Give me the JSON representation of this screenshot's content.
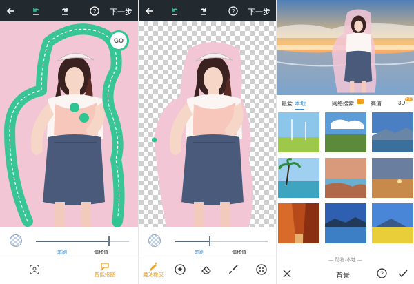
{
  "panel1": {
    "topbar": {
      "back_icon": "arrow-left-icon",
      "undo_icon": "undo-icon",
      "redo_icon": "redo-icon",
      "help_icon": "help-circle-icon",
      "next_label": "下一步"
    },
    "go_label": "GO",
    "slider": {
      "left_label": "笔刷",
      "right_label": "偏移值",
      "value": 0.8
    },
    "toolbar": {
      "left_icon": "face-scan-icon",
      "active_label": "智能抠图"
    }
  },
  "panel2": {
    "topbar": {
      "next_label": "下一步"
    },
    "slider": {
      "left_label": "笔刷",
      "right_label": "偏移值",
      "value": 0.37
    },
    "toolbar": {
      "labels": [
        "魔法橡皮"
      ],
      "icons": [
        "magic-eraser-icon",
        "star-circle-icon",
        "eraser-icon",
        "brush-icon",
        "more-grid-icon"
      ]
    }
  },
  "panel3": {
    "tabs": [
      {
        "label": "最爱"
      },
      {
        "label": "本地"
      },
      {
        "label": "网络搜索"
      },
      {
        "label": "高清"
      },
      {
        "label": "3D"
      }
    ],
    "active_tab": "本地",
    "hd_badge": "HD",
    "section_caption": "— 动物·本地 —",
    "bottom": {
      "title": "背景",
      "close_icon": "close-icon",
      "help_icon": "help-circle-icon",
      "confirm_icon": "check-icon"
    }
  },
  "colors": {
    "topbar_bg": "#222a30",
    "accent_green": "#2fc593",
    "accent_blue": "#3a8fd1",
    "accent_orange": "#f0a020",
    "pink_bg": "#f3c6d6"
  }
}
